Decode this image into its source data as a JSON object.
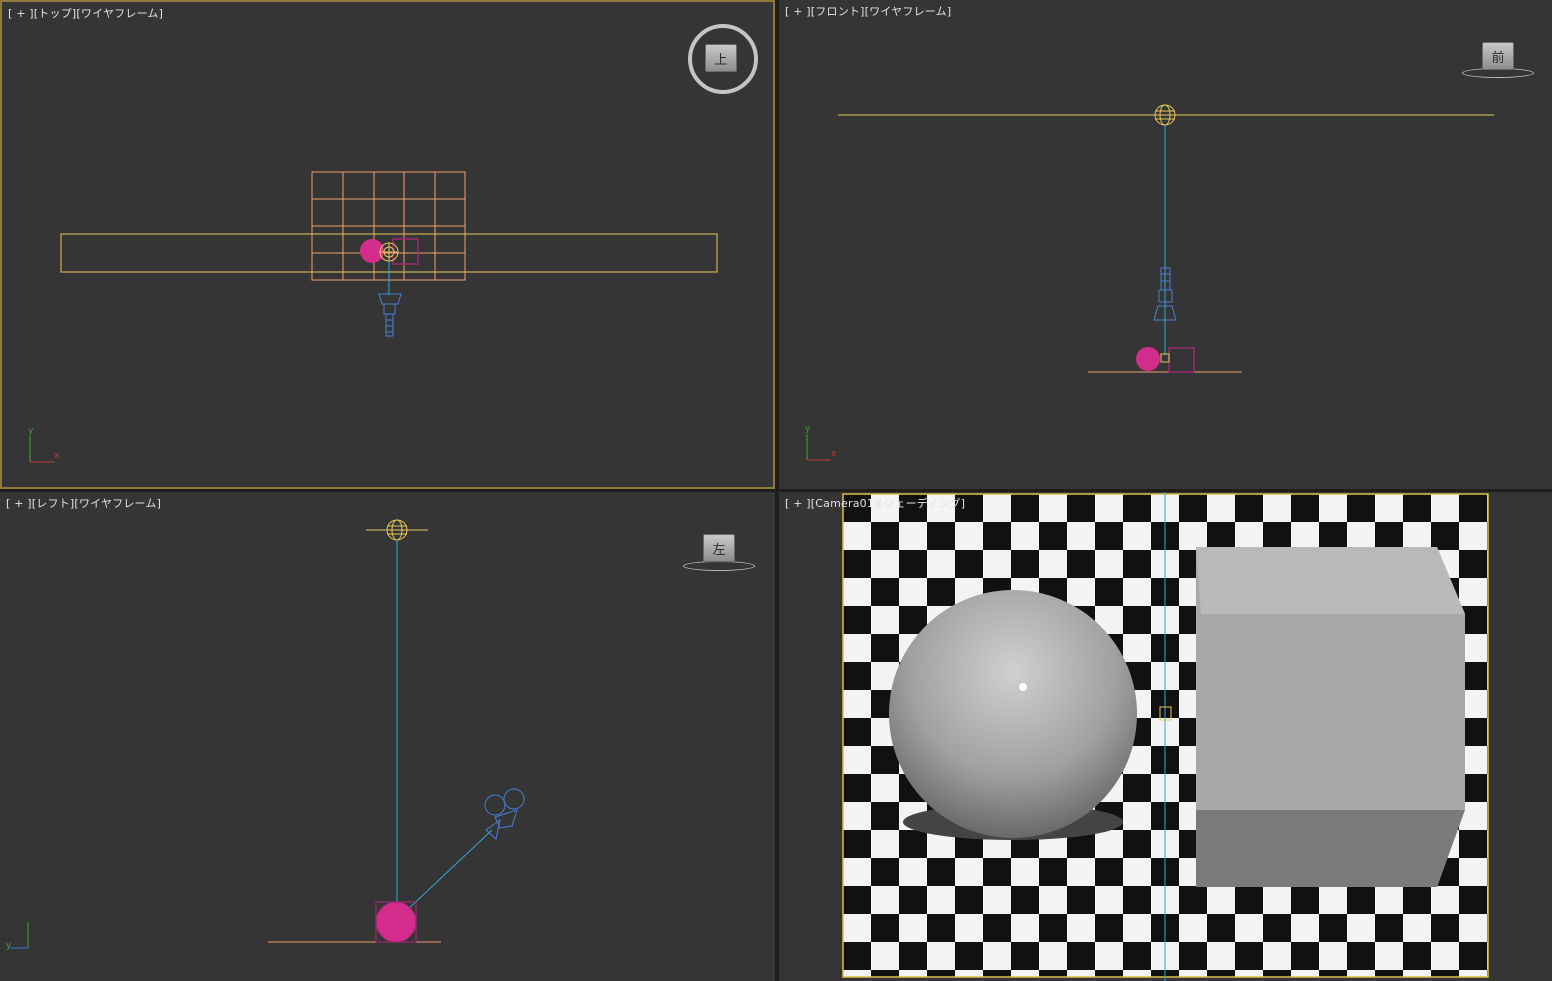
{
  "viewports": {
    "top": {
      "label_open": "[ + ][",
      "label_view": "トップ",
      "label_mid": "][",
      "label_mode": "ワイヤフレーム",
      "label_close": "]",
      "navcube": "上"
    },
    "front": {
      "label_open": "[ + ][",
      "label_view": "フロント",
      "label_mid": "][",
      "label_mode": "ワイヤフレーム",
      "label_close": "]",
      "navcube": "前"
    },
    "left": {
      "label_open": "[ + ][",
      "label_view": "レフト",
      "label_mid": "][",
      "label_mode": "ワイヤフレーム",
      "label_close": "]",
      "navcube": "左"
    },
    "camera": {
      "label_open": "[ + ][",
      "label_view": "Camera01",
      "label_mid": "][",
      "label_mode": "シェーディング",
      "label_close": "]"
    }
  },
  "axes": {
    "x": "x",
    "y": "y"
  },
  "colors": {
    "viewport_bg": "#353535",
    "active_border": "#8f7a3b",
    "light": "#e8c85a",
    "camera": "#4a7fd6",
    "target_line": "#2fa8d8",
    "sphere": "#d32c8c",
    "box": "#9c2a70",
    "ground": "#f0a070"
  }
}
